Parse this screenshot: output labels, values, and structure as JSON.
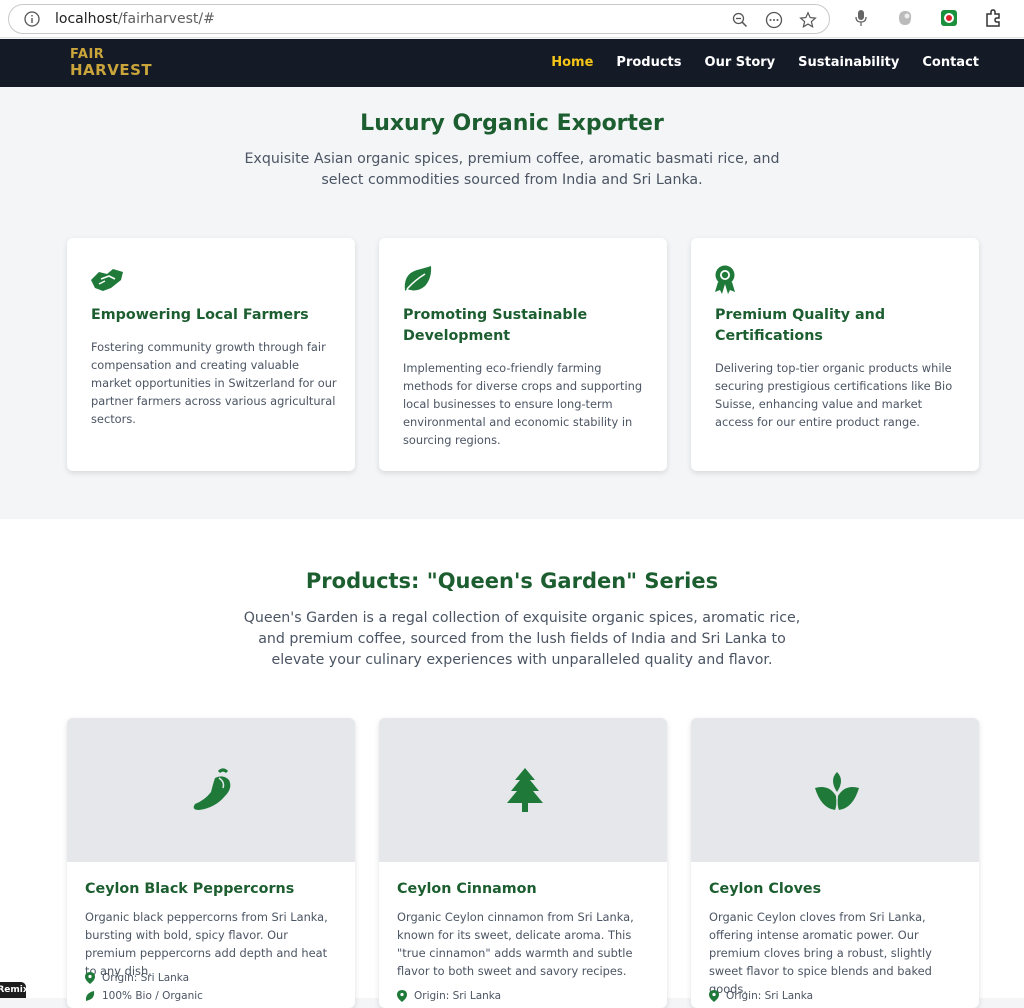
{
  "browser": {
    "url_host": "localhost",
    "url_path": "/fairharvest/#"
  },
  "nav": {
    "logo_line1": "FAIR",
    "logo_line2": "HARVEST",
    "links": [
      {
        "label": "Home",
        "active": true
      },
      {
        "label": "Products",
        "active": false
      },
      {
        "label": "Our Story",
        "active": false
      },
      {
        "label": "Sustainability",
        "active": false
      },
      {
        "label": "Contact",
        "active": false
      }
    ]
  },
  "hero": {
    "title": "Luxury Organic Exporter",
    "subtitle": "Exquisite Asian organic spices, premium coffee, aromatic basmati rice, and select commodities sourced from India and Sri Lanka."
  },
  "features": [
    {
      "icon": "handshake-icon",
      "title": "Empowering Local Farmers",
      "text": "Fostering community growth through fair compensation and creating valuable market opportunities in Switzerland for our partner farmers across various agricultural sectors."
    },
    {
      "icon": "leaf-icon",
      "title": "Promoting Sustainable Development",
      "text": "Implementing eco-friendly farming methods for diverse crops and supporting local businesses to ensure long-term environmental and economic stability in sourcing regions."
    },
    {
      "icon": "award-icon",
      "title": "Premium Quality and Certifications",
      "text": "Delivering top-tier organic products while securing prestigious certifications like Bio Suisse, enhancing value and market access for our entire product range."
    }
  ],
  "products": {
    "title": "Products: \"Queen's Garden\" Series",
    "subtitle": "Queen's Garden is a regal collection of exquisite organic spices, aromatic rice, and premium coffee, sourced from the lush fields of India and Sri Lanka to elevate your culinary experiences with unparalleled quality and flavor.",
    "items": [
      {
        "icon": "pepper-icon",
        "name": "Ceylon Black Peppercorns",
        "desc": "Organic black peppercorns from Sri Lanka, bursting with bold, spicy flavor. Our premium peppercorns add depth and heat to any dish.",
        "origin": "Origin: Sri Lanka",
        "cert": "100% Bio / Organic"
      },
      {
        "icon": "tree-icon",
        "name": "Ceylon Cinnamon",
        "desc": "Organic Ceylon cinnamon from Sri Lanka, known for its sweet, delicate aroma. This \"true cinnamon\" adds warmth and subtle flavor to both sweet and savory recipes.",
        "origin": "Origin: Sri Lanka",
        "cert": ""
      },
      {
        "icon": "seedling-icon",
        "name": "Ceylon Cloves",
        "desc": "Organic Ceylon cloves from Sri Lanka, offering intense aromatic power. Our premium cloves bring a robust, slightly sweet flavor to spice blends and baked goods.",
        "origin": "Origin: Sri Lanka",
        "cert": ""
      }
    ]
  },
  "remix_badge": "Remix",
  "colors": {
    "brand_green": "#1c5e30",
    "accent_gold": "#f5c518",
    "nav_bg": "#141a26"
  }
}
